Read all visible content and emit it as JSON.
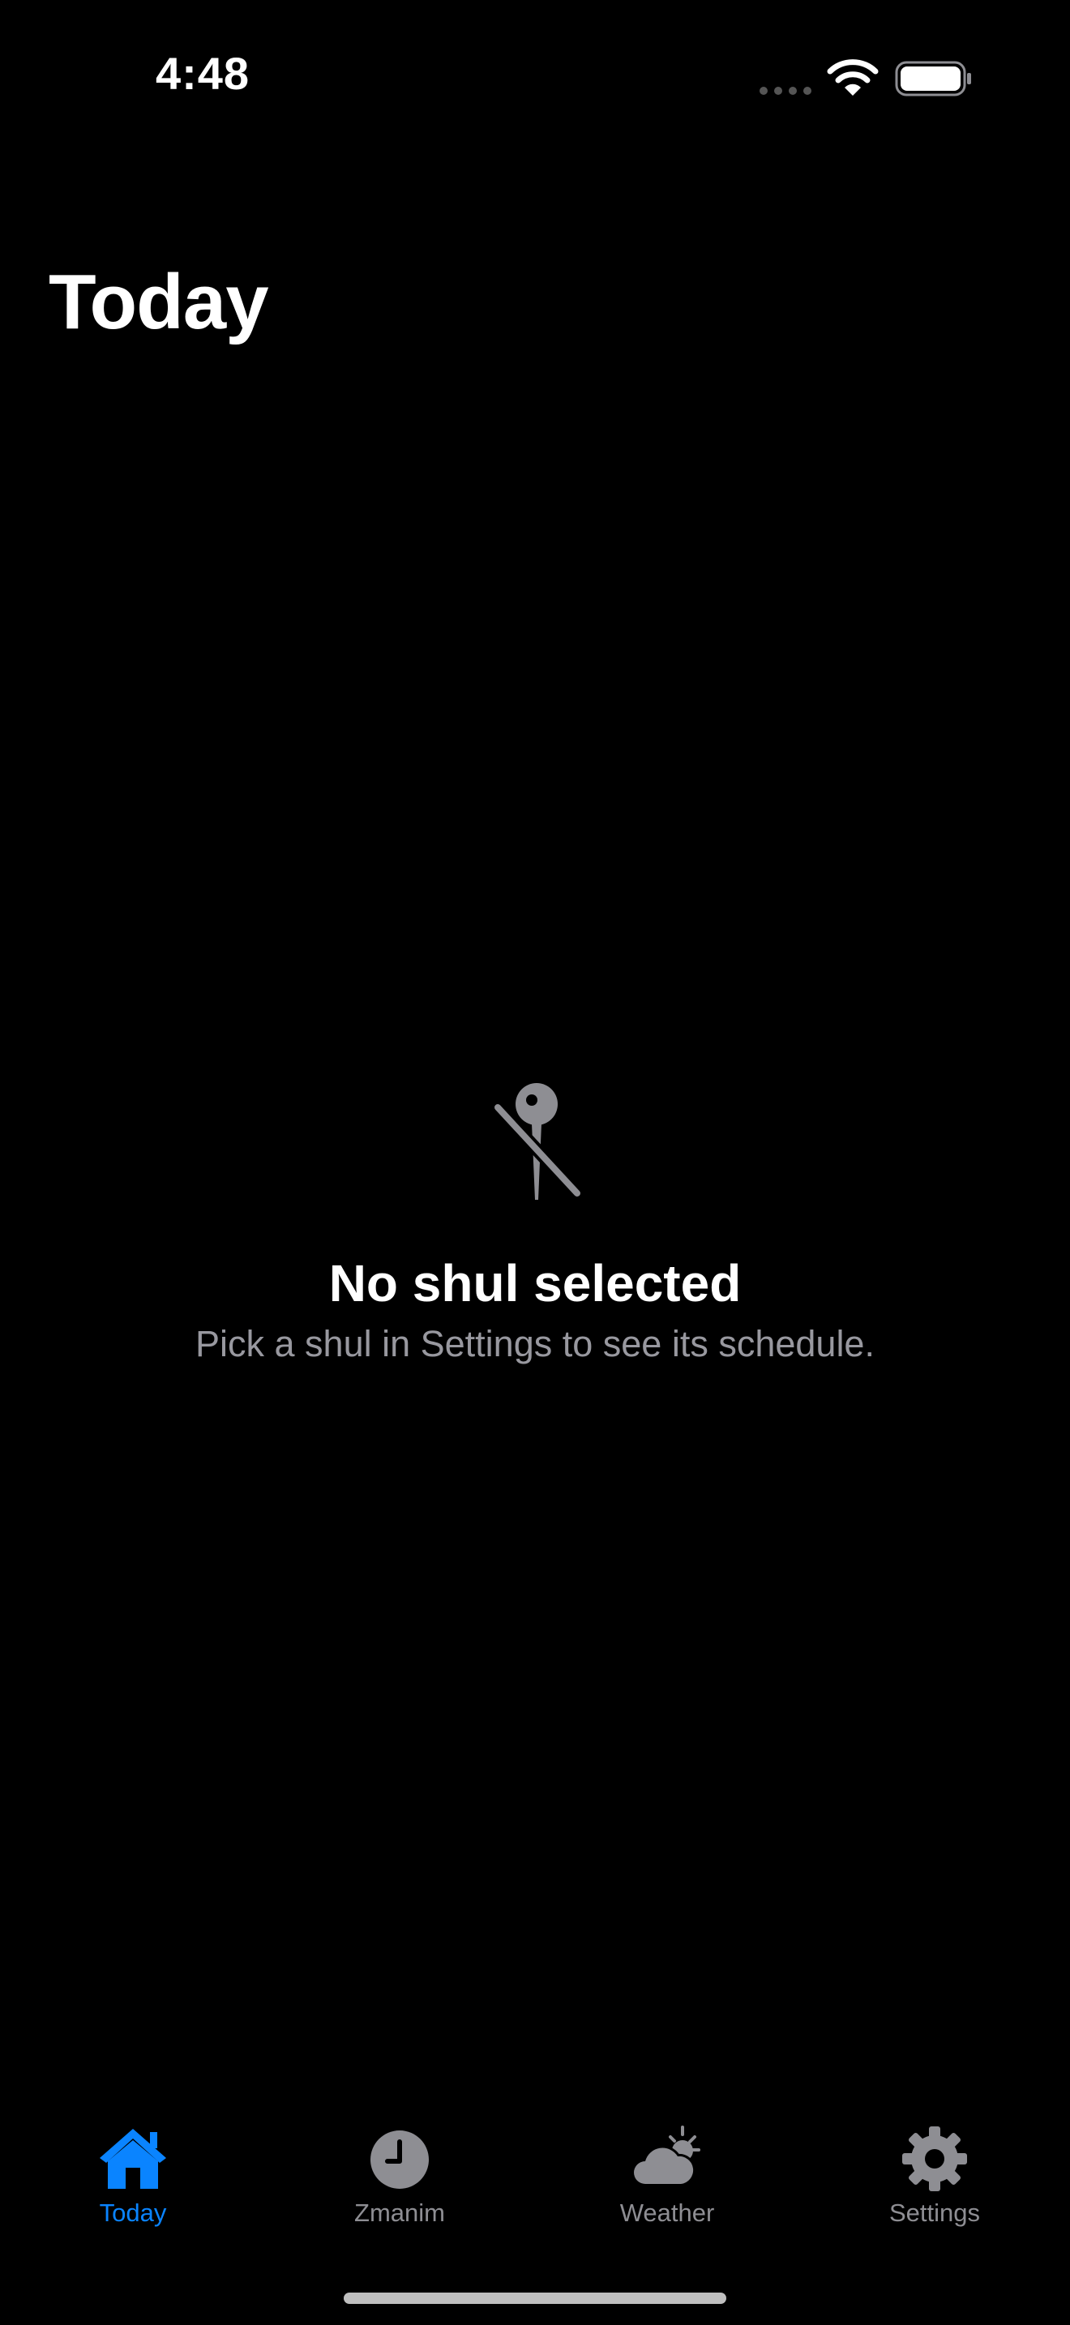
{
  "status_bar": {
    "time": "4:48"
  },
  "header": {
    "title": "Today"
  },
  "empty_state": {
    "icon": "pin-slash-icon",
    "title": "No shul selected",
    "subtitle": "Pick a shul in Settings to see its schedule."
  },
  "tab_bar": {
    "active_color": "#0a84ff",
    "inactive_color": "#8e8e93",
    "tabs": [
      {
        "label": "Today",
        "icon": "house-icon",
        "active": true
      },
      {
        "label": "Zmanim",
        "icon": "clock-icon",
        "active": false
      },
      {
        "label": "Weather",
        "icon": "cloud-sun-icon",
        "active": false
      },
      {
        "label": "Settings",
        "icon": "gear-icon",
        "active": false
      }
    ]
  }
}
